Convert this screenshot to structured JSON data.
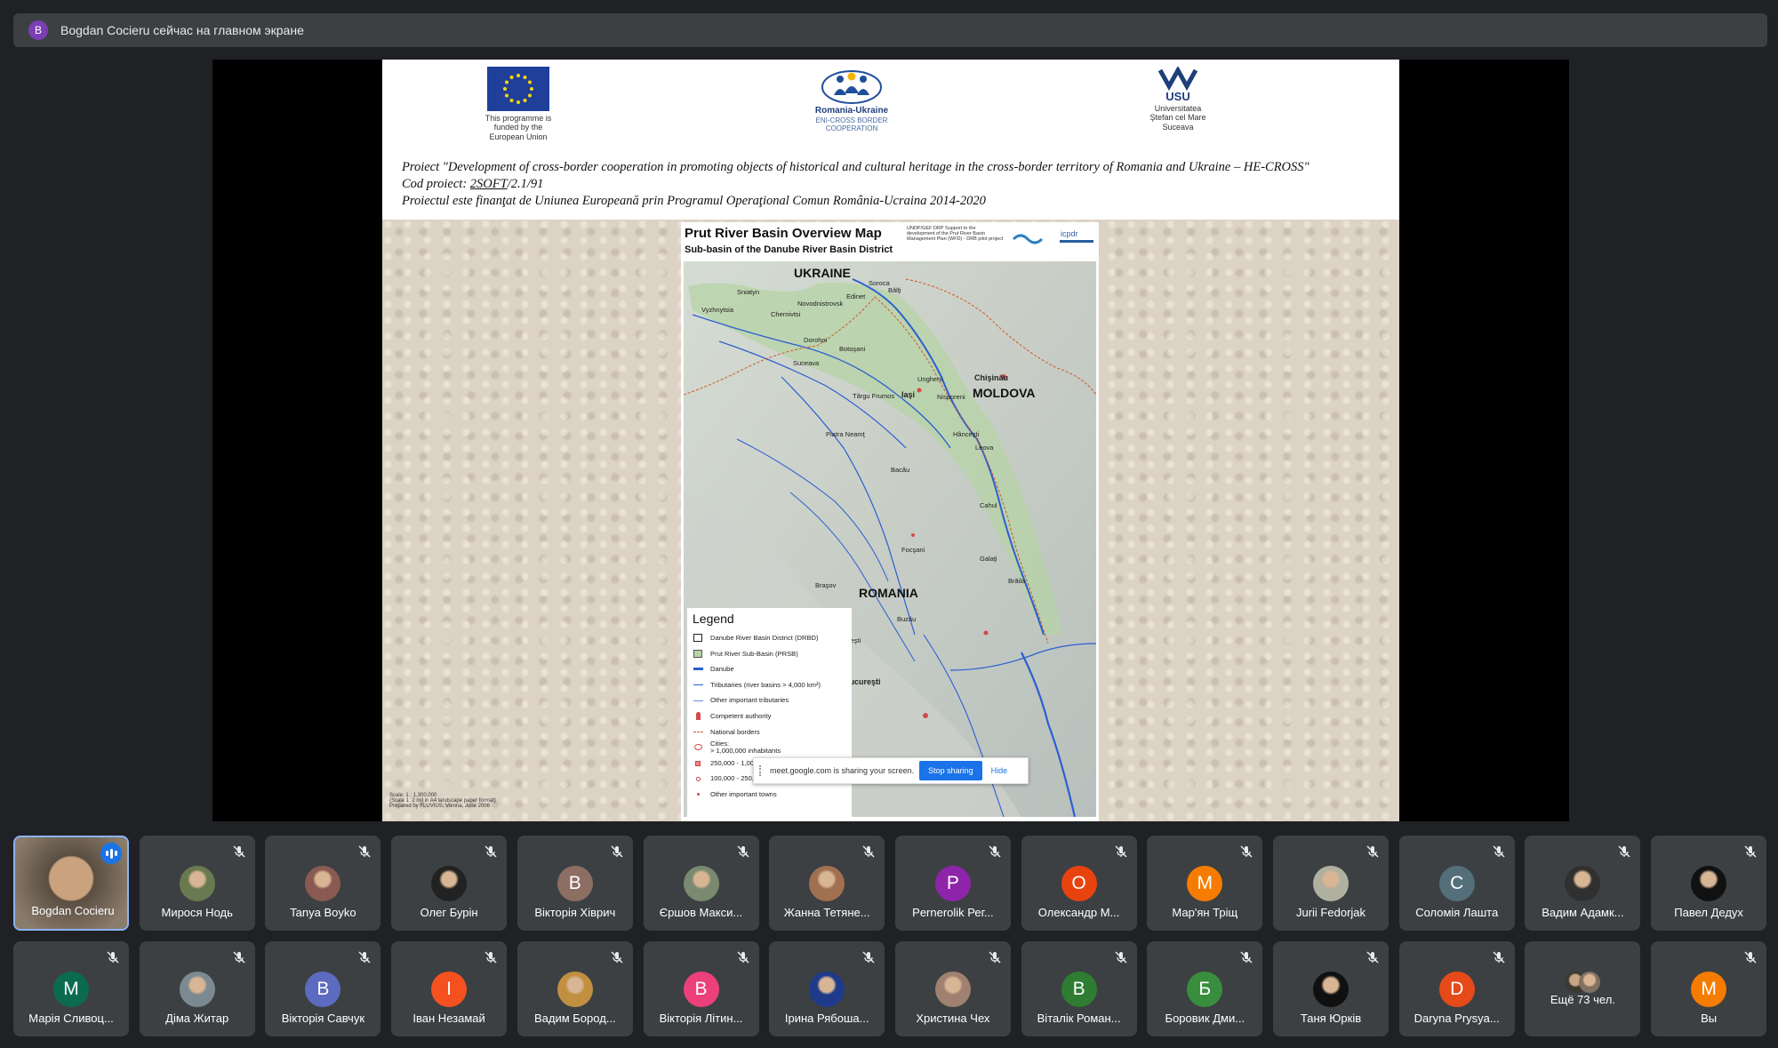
{
  "banner": {
    "avatar_letter": "B",
    "text": "Bogdan Cocieru сейчас на главном экране"
  },
  "slide": {
    "logos": {
      "eu_caption": "This programme is funded by the European Union",
      "ro_ua_title": "Romania-Ukraine",
      "ro_ua_caption": "ENI-CROSS BORDER COOPERATION",
      "usu_letters": "USU",
      "usu_caption": "Universitatea Ştefan cel Mare Suceava"
    },
    "project_line1": "Proiect \"Development of cross-border cooperation in promoting objects of historical and cultural heritage in the cross-border territory of Romania and Ukraine – HE-CROSS\"",
    "project_line2_prefix": "Cod proiect: ",
    "project_line2_code": "2SOFT",
    "project_line2_suffix": "/2.1/91",
    "project_line3": "Proiectul este finanţat de Uniunea Europeană  prin Programul Operaţional Comun România-Ucraina 2014-2020",
    "map": {
      "title": "Prut River Basin Overview Map",
      "subtitle": "Sub-basin of the Danube River Basin District",
      "credit": "UNDP/GEF DRP Support to the development of the Prut River Basin Management Plan (WFD) - DRB pilot project",
      "countries": {
        "ukraine": "UKRAINE",
        "moldova": "MOLDOVA",
        "romania": "ROMANIA"
      },
      "cities": [
        "Chernivtsi",
        "Novodnistrovsk",
        "Edinet",
        "Sniatyn",
        "Vyzhnytsia",
        "Suceava",
        "Dorohoi",
        "Botoşani",
        "Iaşi",
        "Ungheni",
        "Chişinău",
        "Nisporeni",
        "Târgu Frumos",
        "Piatra Neamţ",
        "Bacău",
        "Hânceşti",
        "Leova",
        "Cahul",
        "Galaţi",
        "Brăila",
        "Focşani",
        "Braşov",
        "Buzău",
        "Ploieşti",
        "Bucureşti",
        "Soroca",
        "Bălţi"
      ],
      "legend": {
        "title": "Legend",
        "items": [
          {
            "label": "Danube River Basin District (DRBD)",
            "symbol": "box"
          },
          {
            "label": "Prut River Sub-Basin (PRSB)",
            "symbol": "box-green"
          },
          {
            "label": "Danube",
            "symbol": "thick-line"
          },
          {
            "label": "Tributaries (river basins > 4,000 km²)",
            "symbol": "line"
          },
          {
            "label": "Other important tributaries",
            "symbol": "thin-line"
          },
          {
            "label": "Competent authority",
            "symbol": "pin"
          },
          {
            "label": "National borders",
            "symbol": "dash"
          },
          {
            "label": "Cities:\n> 1,000,000 inhabitants",
            "symbol": "big-dot"
          },
          {
            "label": "250,000 - 1,000,000 inhabitants",
            "symbol": "mid-dot"
          },
          {
            "label": "100,000 - 250,000 inhabitants",
            "symbol": "small-dot"
          },
          {
            "label": "Other important towns",
            "symbol": "tiny-dot"
          }
        ]
      },
      "scale_text": "Scale: 1 : 1,300,000",
      "scale_note": "(Scale 1: 2 mil in A4 landscape paper format)",
      "prepared": "Prepared by FLUVIUS, Vienna, June 2006"
    },
    "share_bar": {
      "message": "meet.google.com is sharing your screen.",
      "stop_label": "Stop sharing",
      "hide_label": "Hide"
    }
  },
  "participants_row1": [
    {
      "name": "Bogdan Cocieru",
      "type": "video",
      "speaking": true
    },
    {
      "name": "Мирося Нодь",
      "type": "photo",
      "color": "#6a7a50"
    },
    {
      "name": "Tanya Boyko",
      "type": "photo",
      "color": "#8a5a50"
    },
    {
      "name": "Олег Бурін",
      "type": "photo",
      "color": "#222222"
    },
    {
      "name": "Вікторія Хіврич",
      "type": "letter",
      "letter": "B",
      "color": "#8d6e63"
    },
    {
      "name": "Єршов Макси...",
      "type": "photo",
      "color": "#7a8a70"
    },
    {
      "name": "Жанна Тетяне...",
      "type": "photo",
      "color": "#a07050"
    },
    {
      "name": "Pernerolik Рег...",
      "type": "letter",
      "letter": "P",
      "color": "#8e24aa"
    },
    {
      "name": "Олександр М...",
      "type": "letter",
      "letter": "O",
      "color": "#e8430f"
    },
    {
      "name": "Мар'ян Тріщ",
      "type": "letter",
      "letter": "M",
      "color": "#f57c00"
    },
    {
      "name": "Jurii Fedorjak",
      "type": "photo",
      "color": "#b0b0a0"
    },
    {
      "name": "Соломія Лашта",
      "type": "letter",
      "letter": "C",
      "color": "#546e7a"
    },
    {
      "name": "Вадим Адамк...",
      "type": "photo",
      "color": "#303030"
    },
    {
      "name": "Павел Дедух",
      "type": "photo",
      "color": "#111111"
    }
  ],
  "participants_row2": [
    {
      "name": "Марія Сливоц...",
      "type": "letter",
      "letter": "M",
      "color": "#0b6b4f"
    },
    {
      "name": "Діма Житар",
      "type": "photo",
      "color": "#7a8a90"
    },
    {
      "name": "Вікторія Савчук",
      "type": "letter",
      "letter": "B",
      "color": "#5c6bc0"
    },
    {
      "name": "Іван Незамай",
      "type": "letter",
      "letter": "I",
      "color": "#f4511e"
    },
    {
      "name": "Вадим Бород...",
      "type": "photo",
      "color": "#c09040"
    },
    {
      "name": "Вікторія Літин...",
      "type": "letter",
      "letter": "B",
      "color": "#ec407a"
    },
    {
      "name": "Ірина Рябоша...",
      "type": "photo",
      "color": "#1e3a8a"
    },
    {
      "name": "Христина Чех",
      "type": "photo",
      "color": "#a08070"
    },
    {
      "name": "Віталік Роман...",
      "type": "letter",
      "letter": "B",
      "color": "#2e7d32"
    },
    {
      "name": "Боровик Дми...",
      "type": "letter",
      "letter": "Б",
      "color": "#388e3c"
    },
    {
      "name": "Таня Юрків",
      "type": "photo",
      "color": "#101010"
    },
    {
      "name": "Daryna Prysya...",
      "type": "letter",
      "letter": "D",
      "color": "#e64a19"
    },
    {
      "name": "Ещё 73 чел.",
      "type": "more"
    },
    {
      "name": "Вы",
      "type": "letter",
      "letter": "M",
      "color": "#f57c00"
    }
  ]
}
